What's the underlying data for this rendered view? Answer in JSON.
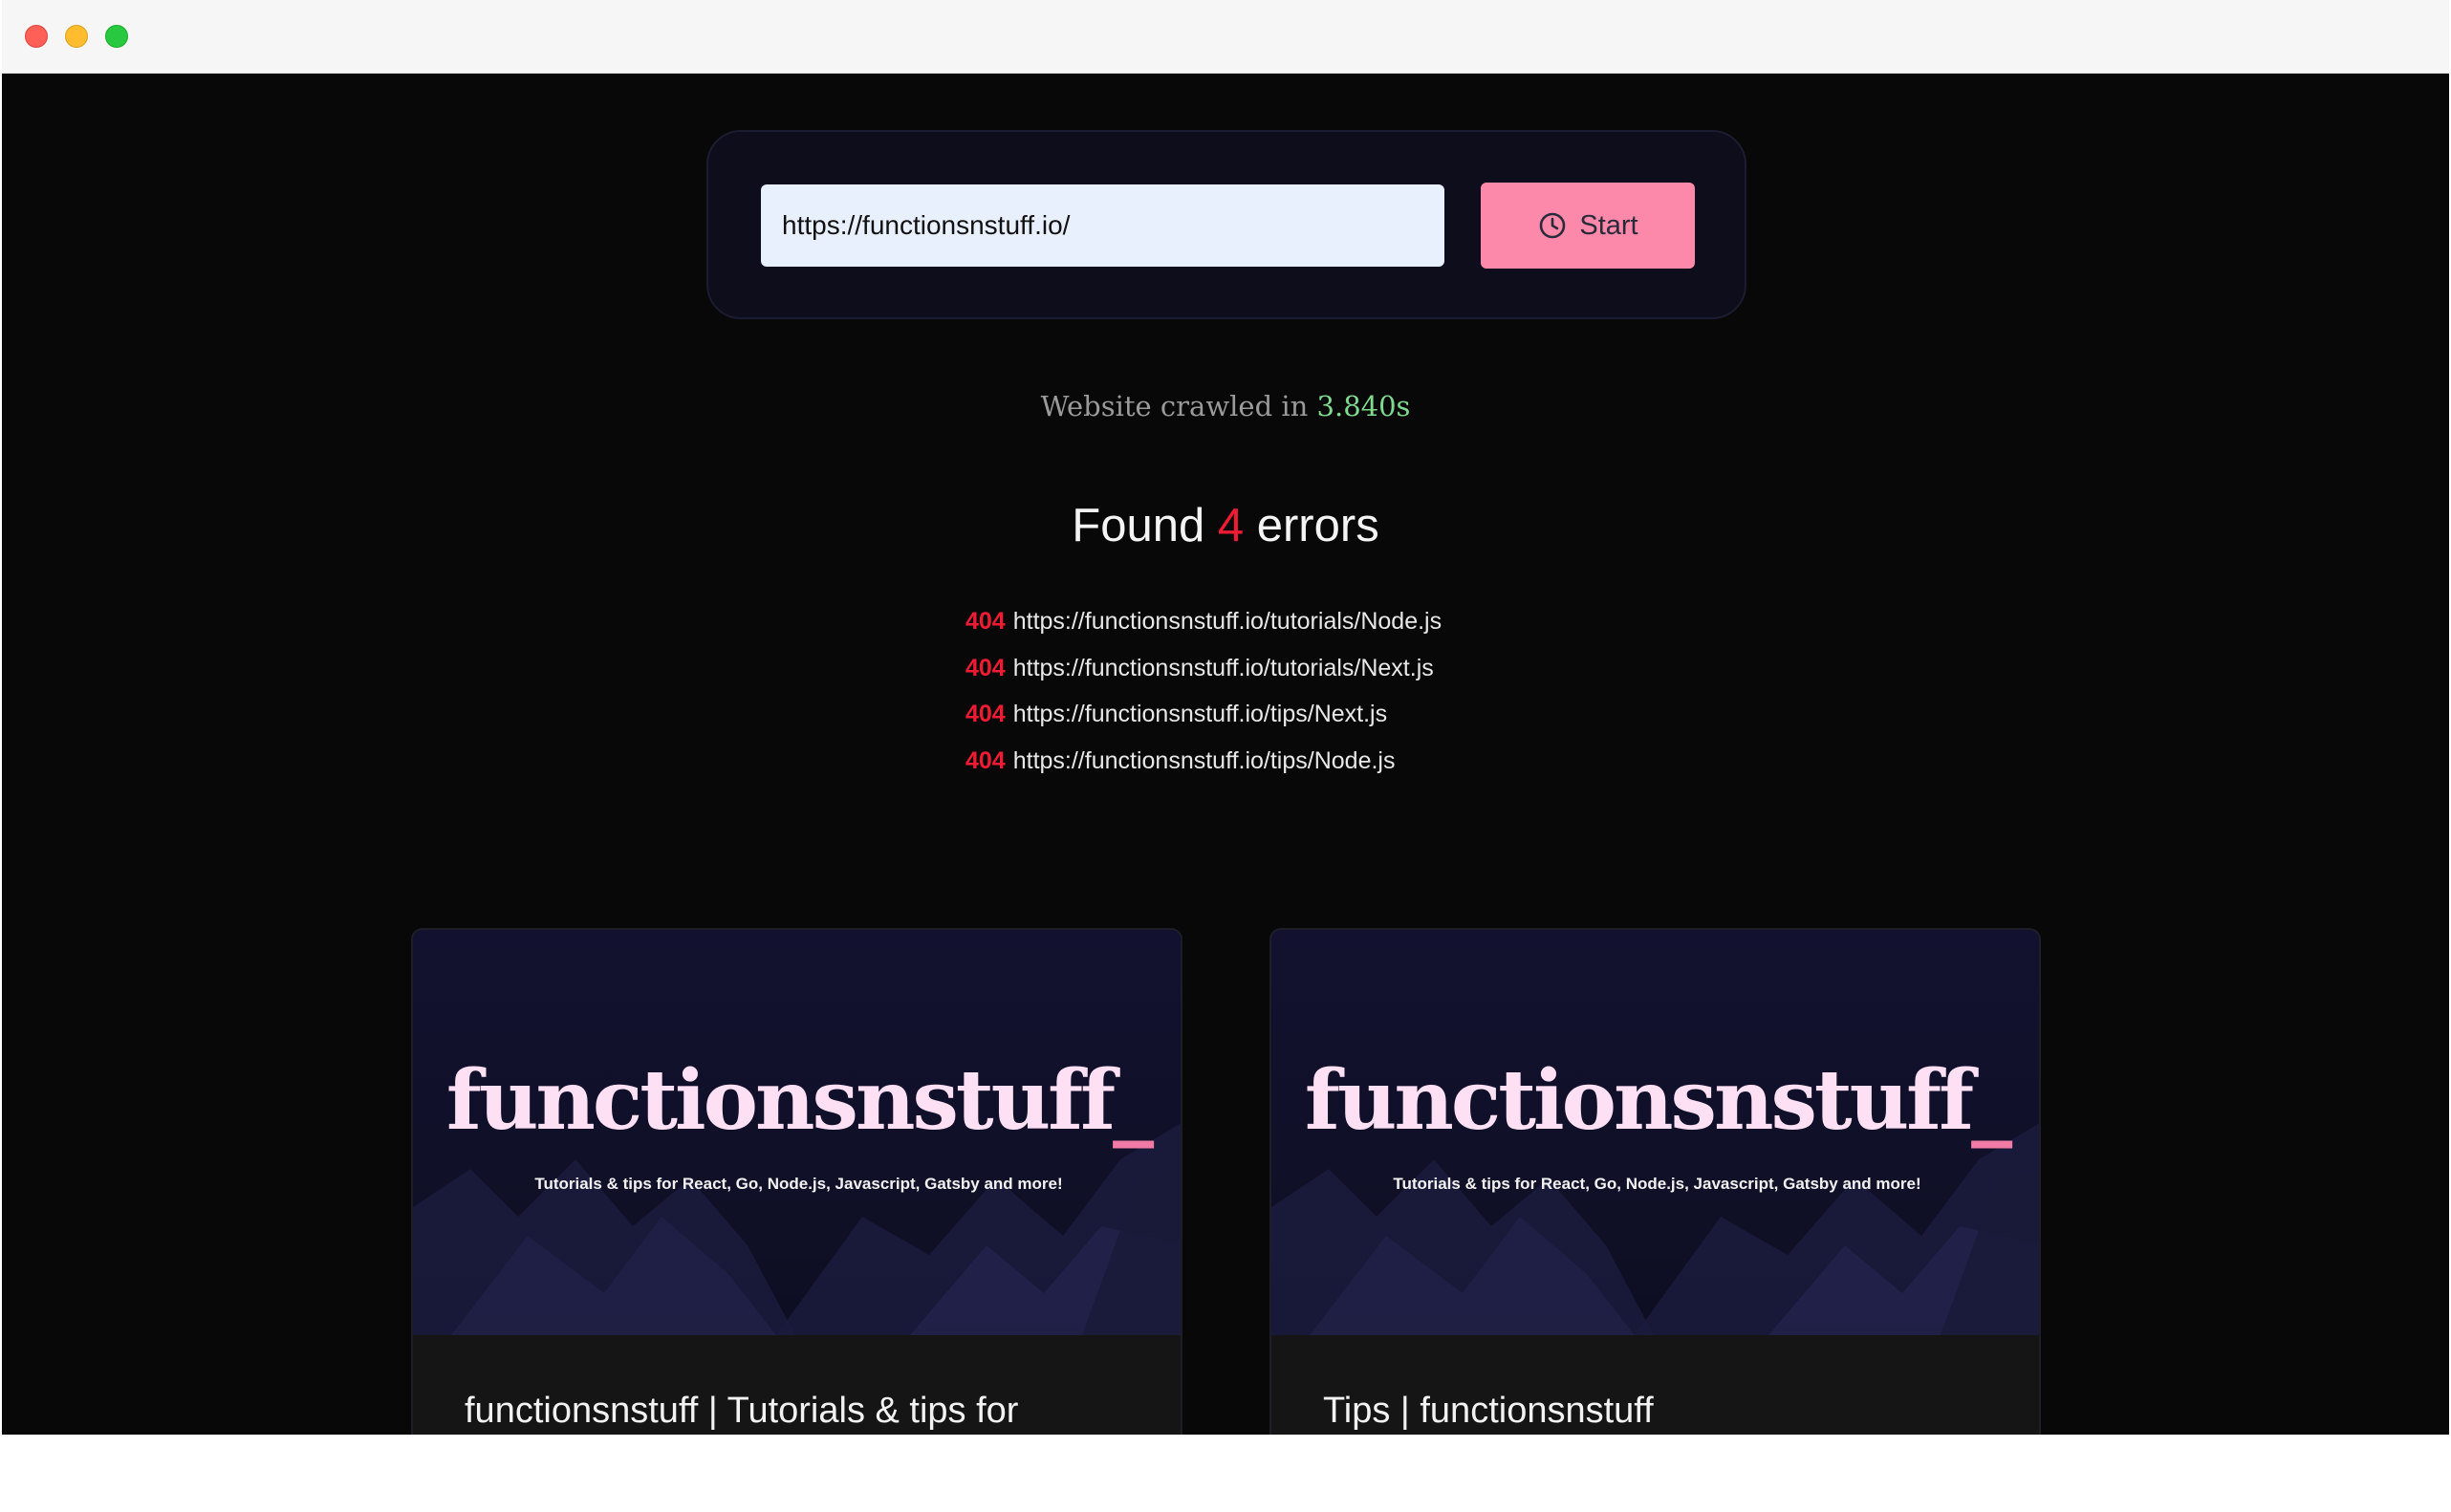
{
  "window": {
    "controls": [
      "close",
      "minimize",
      "zoom"
    ]
  },
  "search": {
    "url_value": "https://functionsnstuff.io/",
    "start_label": "Start",
    "start_icon": "clock-icon"
  },
  "crawl": {
    "prefix": "Website crawled in ",
    "time": "3.840s"
  },
  "errors": {
    "heading_prefix": "Found ",
    "count": "4",
    "heading_suffix": " errors",
    "items": [
      {
        "code": "404",
        "url": "https://functionsnstuff.io/tutorials/Node.js"
      },
      {
        "code": "404",
        "url": "https://functionsnstuff.io/tutorials/Next.js"
      },
      {
        "code": "404",
        "url": "https://functionsnstuff.io/tips/Next.js"
      },
      {
        "code": "404",
        "url": "https://functionsnstuff.io/tips/Node.js"
      }
    ]
  },
  "cards": [
    {
      "logo_text": "functionsnstuff",
      "logo_underscore": "_",
      "tagline": "Tutorials & tips for React, Go, Node.js, Javascript, Gatsby and more!",
      "title": "functionsnstuff | Tutorials & tips for"
    },
    {
      "logo_text": "functionsnstuff",
      "logo_underscore": "_",
      "tagline": "Tutorials & tips for React, Go, Node.js, Javascript, Gatsby and more!",
      "title": "Tips | functionsnstuff"
    }
  ],
  "colors": {
    "page_bg": "#080808",
    "panel_bg": "#0d0d1c",
    "input_bg": "#e8f0fe",
    "button_bg": "#fc89a9",
    "success_text": "#7fd98f",
    "error_red": "#ef1b32",
    "logo_pink": "#fde0f4",
    "underscore_pink": "#f27ba6"
  }
}
